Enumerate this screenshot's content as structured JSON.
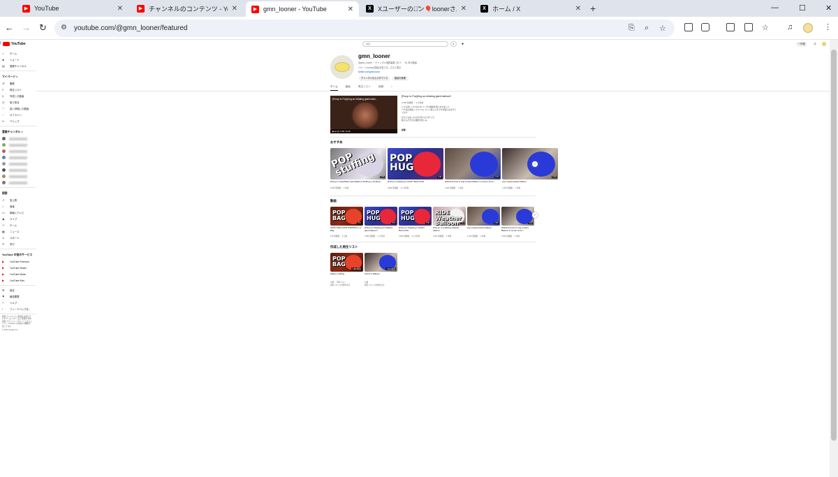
{
  "browser": {
    "tabs": [
      {
        "title": "YouTube",
        "icon": "youtube-icon"
      },
      {
        "title": "チャンネルのコンテンツ - YouTube S",
        "icon": "youtube-icon"
      },
      {
        "title": "gmn_looner - YouTube",
        "icon": "youtube-icon",
        "active": true
      },
      {
        "title": "Xユーザーのゲ̃ン🎈loonerさん: 「こ",
        "icon": "x-icon"
      },
      {
        "title": "ホーム / X",
        "icon": "x-icon"
      }
    ],
    "new_tab": "+",
    "url": "youtube.com/@gmn_looner/featured",
    "window_controls": {
      "minimize": "—",
      "maximize": "☐",
      "close": "✕"
    }
  },
  "yt": {
    "logo": "YouTube",
    "search_placeholder": "検索",
    "create": "+ 作成",
    "sidebar": {
      "main": [
        {
          "icon": "home-icon",
          "glyph": "⌂",
          "label": "ホーム"
        },
        {
          "icon": "shorts-icon",
          "glyph": "◈",
          "label": "ショート"
        },
        {
          "icon": "subscriptions-icon",
          "glyph": "▤",
          "label": "登録チャンネル"
        }
      ],
      "you_heading": "マイページ  >",
      "you": [
        {
          "icon": "history-icon",
          "glyph": "↺",
          "label": "履歴"
        },
        {
          "icon": "playlist-icon",
          "glyph": "≡",
          "label": "再生リスト"
        },
        {
          "icon": "your-videos-icon",
          "glyph": "▷",
          "label": "作成した動画"
        },
        {
          "icon": "watch-later-icon",
          "glyph": "◷",
          "label": "後で見る"
        },
        {
          "icon": "liked-icon",
          "glyph": "♡",
          "label": "高く評価した動画"
        },
        {
          "icon": "download-icon",
          "glyph": "↓",
          "label": "オフライン"
        },
        {
          "icon": "clips-icon",
          "glyph": "✂",
          "label": "クリップ"
        }
      ],
      "subs_heading": "登録チャンネル  >",
      "explore_heading": "探索",
      "explore": [
        {
          "icon": "trending-icon",
          "glyph": "↗",
          "label": "急上昇"
        },
        {
          "icon": "music-icon",
          "glyph": "♪",
          "label": "音楽"
        },
        {
          "icon": "movies-icon",
          "glyph": "▭",
          "label": "映画とテレビ"
        },
        {
          "icon": "live-icon",
          "glyph": "◉",
          "label": "ライブ"
        },
        {
          "icon": "gaming-icon",
          "glyph": "⚇",
          "label": "ゲーム"
        },
        {
          "icon": "news-icon",
          "glyph": "▦",
          "label": "ニュース"
        },
        {
          "icon": "sports-icon",
          "glyph": "♕",
          "label": "スポーツ"
        },
        {
          "icon": "learning-icon",
          "glyph": "✎",
          "label": "学び"
        }
      ],
      "more_heading": "YouTube の他のサービス",
      "more": [
        {
          "icon": "yt-premium-icon",
          "label": "YouTube Premium"
        },
        {
          "icon": "yt-studio-icon",
          "label": "YouTube Studio"
        },
        {
          "icon": "yt-music-icon",
          "label": "YouTube Music"
        },
        {
          "icon": "yt-kids-icon",
          "label": "YouTube Kids"
        }
      ],
      "settings": [
        {
          "icon": "settings-icon",
          "glyph": "⚙",
          "label": "設定"
        },
        {
          "icon": "report-icon",
          "glyph": "⚑",
          "label": "報告履歴"
        },
        {
          "icon": "help-icon",
          "glyph": "?",
          "label": "ヘルプ"
        },
        {
          "icon": "feedback-icon",
          "glyph": "!",
          "label": "フィードバックを..."
        }
      ],
      "footer": "概要 プレスルーム 著作権 お問い合わせ クリエイター 広告 開発者 利用規約 プライバシー ポリシーとセキュリティ YouTube の仕組み 新機能を試してみる",
      "copyright": "© 2024 Google LLC"
    },
    "channel": {
      "name": "gmn_looner",
      "meta": "@gmn_looner ・チャンネル登録者数 1万人 ・ 61 本の動画",
      "description": "バルーンlooner(風船)を愛でる...さらに表示",
      "link": "twitter.com/gmnlooner",
      "customize": "チャンネルをカスタマイズ",
      "manage": "動画を管理",
      "tabs": [
        "ホーム",
        "動画",
        "再生リスト",
        "投稿"
      ],
      "search_glyph": "⌕"
    },
    "featured": {
      "thumb_title": "[Pump to Pop]Hug an inflating giant ballo...",
      "title": "[Pump to Pop]Hug an inflating giant balloon!!",
      "meta": "3,086 回視聴 ・ 1 か月前",
      "description": "とても楽しく大きな 60 インチの風船を膨らませました\nハグは心地良くフワフワしていて楽しいのですが膨らみすぎて\nフロウ\n\nぜひとも長くなりますね (ぶつかって)\n膨らんだ大きな風船を楽しみ",
      "more": "詳細",
      "time": "0:00 / 5:29"
    },
    "sections": {
      "recommended": "おすすめ",
      "videos": "動画",
      "playlists": "作成した再生リスト"
    },
    "recommended": [
      {
        "title": "[Pump to Pop]White Giant Balloon Stuffing in 16-Burst",
        "meta": "5,830 回視聴 ・ 1 年前",
        "duration": "6:29",
        "caption": "POP stuffing"
      },
      {
        "title": "[Pump to Pop]Hug a GIANT BALLOON",
        "meta": "4,806 回視聴 ・ 11 か月前",
        "duration": "4:48",
        "caption": "POP HUG"
      },
      {
        "title": "[Part3] Forced to hug a Giant Balloon in looner arms !",
        "meta": "2,006 回視聴 ・ 1 年前",
        "duration": "3:04",
        "caption": ""
      },
      {
        "title": "pop a deteriorated balloon",
        "meta": "1,203 回視聴 ・ 2 年前",
        "duration": "2:58",
        "caption": ""
      }
    ],
    "videos": [
      {
        "title": "GIANT BALLOON POPPING in a Bag",
        "meta": "674 回視聴 ・ 3 日前",
        "duration": "3:16",
        "caption": "POP BAG"
      },
      {
        "title": "[Pump to Pop]Hug an inflating giant balloon!!",
        "meta": "3,086 回視聴 ・ 1 か月前",
        "duration": "5:29",
        "caption": "POP HUG"
      },
      {
        "title": "[Pump to Pop]Hug a GIANT BALLOON",
        "meta": "4,806 回視聴 ・ 11 か月前",
        "duration": "4:48",
        "caption": "POP HUG"
      },
      {
        "title": "Ride an un-inflating weather balloon",
        "meta": "2,541 回視聴 ・ 1 年前",
        "duration": "1:41",
        "caption": "RIDE Weather Balloon"
      },
      {
        "title": "pop a deteriorated balloon",
        "meta": "1,203 回視聴 ・ 2 年前",
        "duration": "2:58",
        "caption": ""
      },
      {
        "title": "[Part3] Forced to hug a Giant Balloon in looner arms !",
        "meta": "2,006 回視聴 ・ 1 年前",
        "duration": "3:04",
        "caption": ""
      }
    ],
    "playlists": [
      {
        "title": "balloon stuffing",
        "meta": "公開 ・ 再生リスト",
        "count": "7 本の動画",
        "link": "再生リストの全体を見る",
        "caption": "POP BAG"
      },
      {
        "title": "Climb to Balloon",
        "meta": "公開",
        "count": "3 本の動画",
        "link": "再生リストの全体を見る",
        "caption": ""
      }
    ]
  }
}
